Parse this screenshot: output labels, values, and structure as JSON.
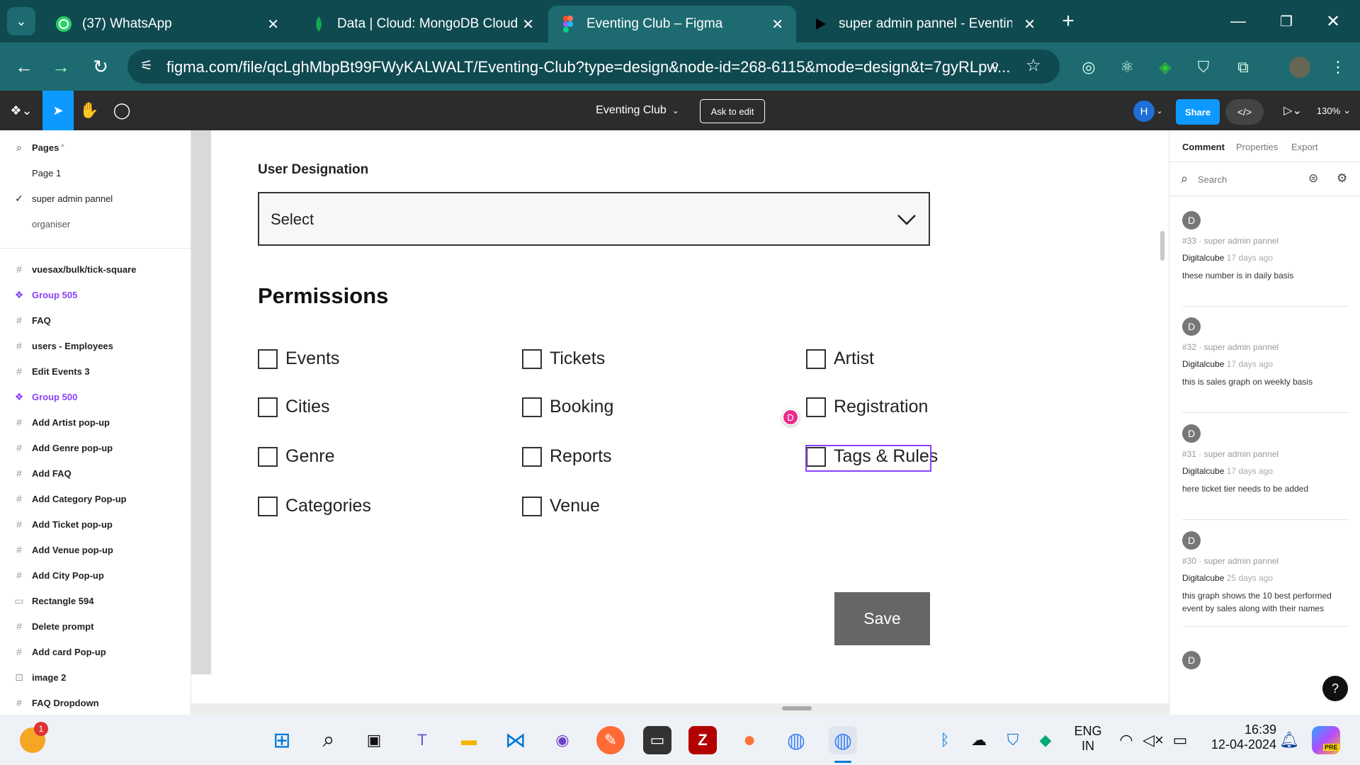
{
  "browser": {
    "tabs": [
      {
        "title": "(37) WhatsApp",
        "icon": "whatsapp-icon"
      },
      {
        "title": "Data | Cloud: MongoDB Cloud",
        "icon": "mongodb-icon"
      },
      {
        "title": "Eventing Club – Figma",
        "icon": "figma-icon",
        "active": true
      },
      {
        "title": "super admin pannel - Eventing",
        "icon": "youtube-icon"
      }
    ],
    "new_tab": "+",
    "url": "figma.com/file/qcLghMbpBt99FWyKALWALT/Eventing-Club?type=design&node-id=268-6115&mode=design&t=7gyRLpw..."
  },
  "figma_toolbar": {
    "file_name": "Eventing Club",
    "ask_to_edit": "Ask to edit",
    "user_initial": "H",
    "share": "Share",
    "zoom": "130%"
  },
  "left_panel": {
    "pages_label": "Pages",
    "pages": [
      "Page 1",
      "super admin pannel",
      "organiser"
    ],
    "current_page": "super admin pannel",
    "layers": [
      {
        "name": "vuesax/bulk/tick-square",
        "icon": "frame-icon"
      },
      {
        "name": "Group 505",
        "icon": "component-icon",
        "purple": true
      },
      {
        "name": "FAQ",
        "icon": "frame-icon"
      },
      {
        "name": "users - Employees",
        "icon": "frame-icon"
      },
      {
        "name": "Edit Events 3",
        "icon": "frame-icon"
      },
      {
        "name": "Group 500",
        "icon": "component-icon",
        "purple": true
      },
      {
        "name": "Add Artist pop-up",
        "icon": "frame-icon"
      },
      {
        "name": "Add Genre pop-up",
        "icon": "frame-icon"
      },
      {
        "name": "Add FAQ",
        "icon": "frame-icon"
      },
      {
        "name": "Add Category Pop-up",
        "icon": "frame-icon"
      },
      {
        "name": "Add Ticket pop-up",
        "icon": "frame-icon"
      },
      {
        "name": "Add Venue pop-up",
        "icon": "frame-icon"
      },
      {
        "name": "Add City Pop-up",
        "icon": "frame-icon"
      },
      {
        "name": "Rectangle 594",
        "icon": "rectangle-icon"
      },
      {
        "name": "Delete prompt",
        "icon": "frame-icon"
      },
      {
        "name": "Add card Pop-up",
        "icon": "frame-icon"
      },
      {
        "name": "image 2",
        "icon": "image-icon"
      },
      {
        "name": "FAQ Dropdown",
        "icon": "frame-icon"
      }
    ]
  },
  "design": {
    "designation_label": "User Designation",
    "select_placeholder": "Select",
    "permissions_title": "Permissions",
    "permissions": [
      [
        "Events",
        "Tickets",
        "Artist"
      ],
      [
        "Cities",
        "Booking",
        "Registration"
      ],
      [
        "Genre",
        "Reports",
        "Tags & Rules"
      ],
      [
        "Categories",
        "Venue"
      ]
    ],
    "save_label": "Save",
    "cursor_initial": "D"
  },
  "right_panel": {
    "tabs": [
      "Comment",
      "Properties",
      "Export"
    ],
    "active_tab": "Comment",
    "search_placeholder": "Search",
    "comments": [
      {
        "avatar": "D",
        "meta": "#33 · super admin pannel",
        "author": "Digitalcube",
        "time": "17 days ago",
        "text": "these number is in daily basis"
      },
      {
        "avatar": "D",
        "meta": "#32 · super admin pannel",
        "author": "Digitalcube",
        "time": "17 days ago",
        "text": "this is sales graph on weekly basis"
      },
      {
        "avatar": "D",
        "meta": "#31 · super admin pannel",
        "author": "Digitalcube",
        "time": "17 days ago",
        "text": "here ticket tier needs to be added"
      },
      {
        "avatar": "D",
        "meta": "#30 · super admin pannel",
        "author": "Digitalcube",
        "time": "25 days ago",
        "text": "this graph shows the 10 best performed event by sales along with their names"
      },
      {
        "avatar": "D"
      }
    ],
    "help": "?"
  },
  "taskbar": {
    "lang_top": "ENG",
    "lang_bottom": "IN",
    "time": "16:39",
    "date": "12-04-2024",
    "weather_badge": "1",
    "copilot_badge": "PRE"
  }
}
